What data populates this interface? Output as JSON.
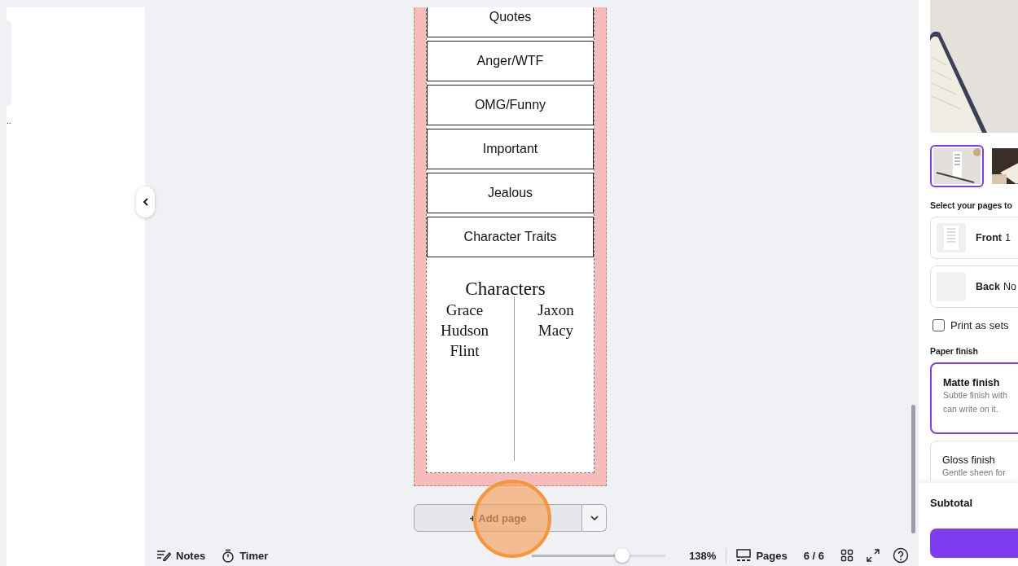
{
  "left_panel": {
    "text": ".."
  },
  "bookmark": {
    "tabs": [
      {
        "label": "Quotes"
      },
      {
        "label": "Anger/WTF"
      },
      {
        "label": "OMG/Funny"
      },
      {
        "label": "Important"
      },
      {
        "label": "Jealous"
      },
      {
        "label": "Character Traits"
      }
    ],
    "characters": {
      "title": "Characters",
      "left": [
        "Grace",
        "Hudson",
        "Flint"
      ],
      "right": [
        "Jaxon",
        "Macy"
      ]
    }
  },
  "add_page": {
    "label": "+ Add page"
  },
  "bottom_bar": {
    "notes": "Notes",
    "timer": "Timer",
    "zoom": {
      "level": 0.66,
      "reading": "138%"
    },
    "pages": "Pages",
    "page_count": "6 / 6"
  },
  "product_panel": {
    "thumbnails": [
      {
        "selected": true
      },
      {
        "selected": false
      }
    ],
    "pages_heading": "Select your pages to",
    "page_options": [
      {
        "label": "Front",
        "value": "1",
        "preview": true
      },
      {
        "label": "Back",
        "value": "No",
        "preview": false
      }
    ],
    "print_as_sets": {
      "label": "Print as sets",
      "checked": false
    },
    "finish_heading": "Paper finish",
    "finishes": [
      {
        "name": "Matte finish",
        "description": "Subtle finish with can write on it.",
        "selected": true
      },
      {
        "name": "Gloss finish",
        "description": "Gentle sheen for",
        "selected": false
      }
    ],
    "subtotal": "Subtotal"
  }
}
